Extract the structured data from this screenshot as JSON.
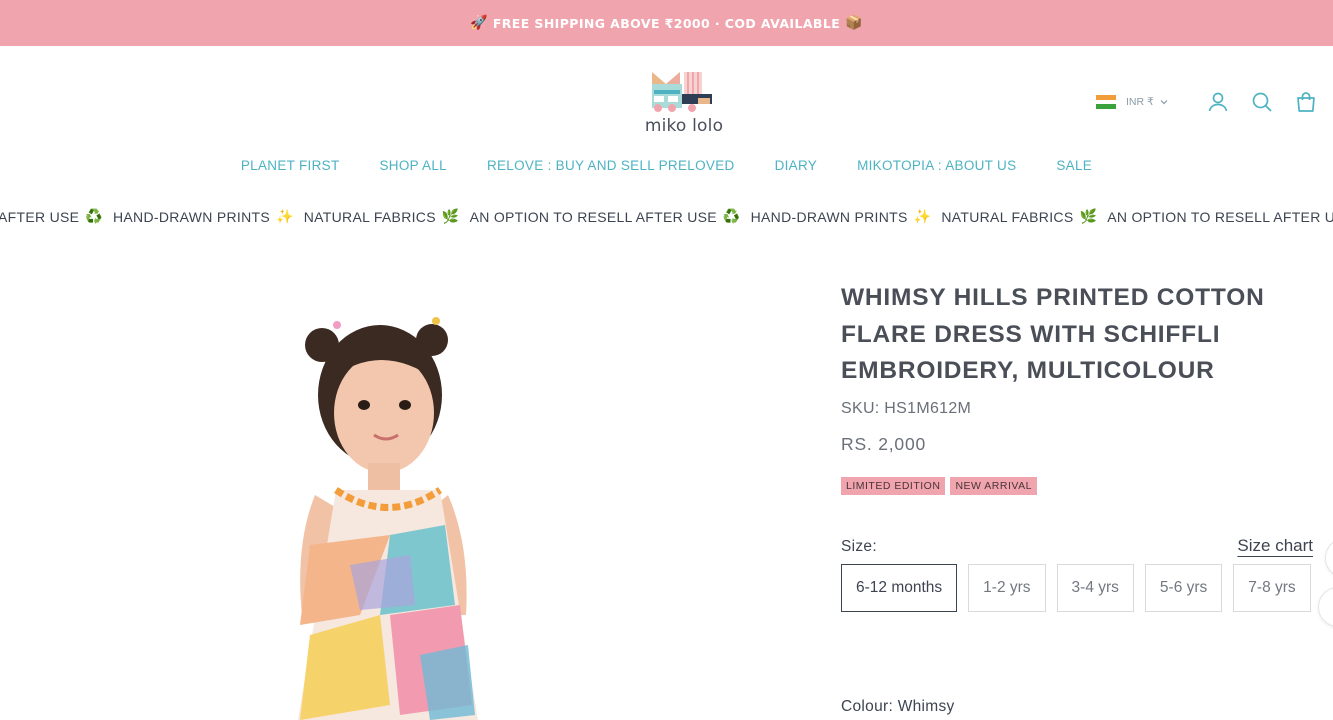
{
  "announcement": {
    "left_emoji": "🚀",
    "text": "FREE SHIPPING ABOVE ₹2000 · COD AVAILABLE",
    "right_emoji": "📦"
  },
  "header": {
    "logo_text": "miko lolo",
    "currency": "INR ₹",
    "icons": [
      "account-icon",
      "search-icon",
      "cart-icon"
    ]
  },
  "nav": {
    "items": [
      "PLANET FIRST",
      "SHOP ALL",
      "RELOVE : BUY AND SELL PRELOVED",
      "DIARY",
      "MIKOTOPIA : ABOUT US",
      "SALE"
    ]
  },
  "marquee": {
    "items": [
      {
        "text": "AFTER USE",
        "emoji": "♻️"
      },
      {
        "text": "HAND-DRAWN PRINTS",
        "emoji": "✨"
      },
      {
        "text": "NATURAL FABRICS",
        "emoji": "🌿"
      },
      {
        "text": "AN OPTION TO RESELL AFTER USE",
        "emoji": "♻️"
      },
      {
        "text": "HAND-DRAWN PRINTS",
        "emoji": "✨"
      },
      {
        "text": "NATURAL FABRICS",
        "emoji": "🌿"
      },
      {
        "text": "AN OPTION TO RESELL AFTER USE",
        "emoji": "♻️"
      }
    ]
  },
  "product": {
    "title": "WHIMSY HILLS PRINTED COTTON FLARE DRESS WITH SCHIFFLI EMBROIDERY, MULTICOLOUR",
    "sku": "SKU: HS1M612M",
    "price": "RS. 2,000",
    "badges": [
      "LIMITED EDITION",
      "NEW ARRIVAL"
    ],
    "size_label": "Size:",
    "size_chart": "Size chart",
    "sizes": [
      "6-12 months",
      "1-2 yrs",
      "3-4 yrs",
      "5-6 yrs",
      "7-8 yrs"
    ],
    "selected_size": "6-12 months",
    "colour_label": "Colour:",
    "colour_value": "Whimsy"
  },
  "colors": {
    "announcement_bg": "#f0a5ae",
    "nav": "#4db3c2",
    "text_dark": "#3d4451"
  }
}
